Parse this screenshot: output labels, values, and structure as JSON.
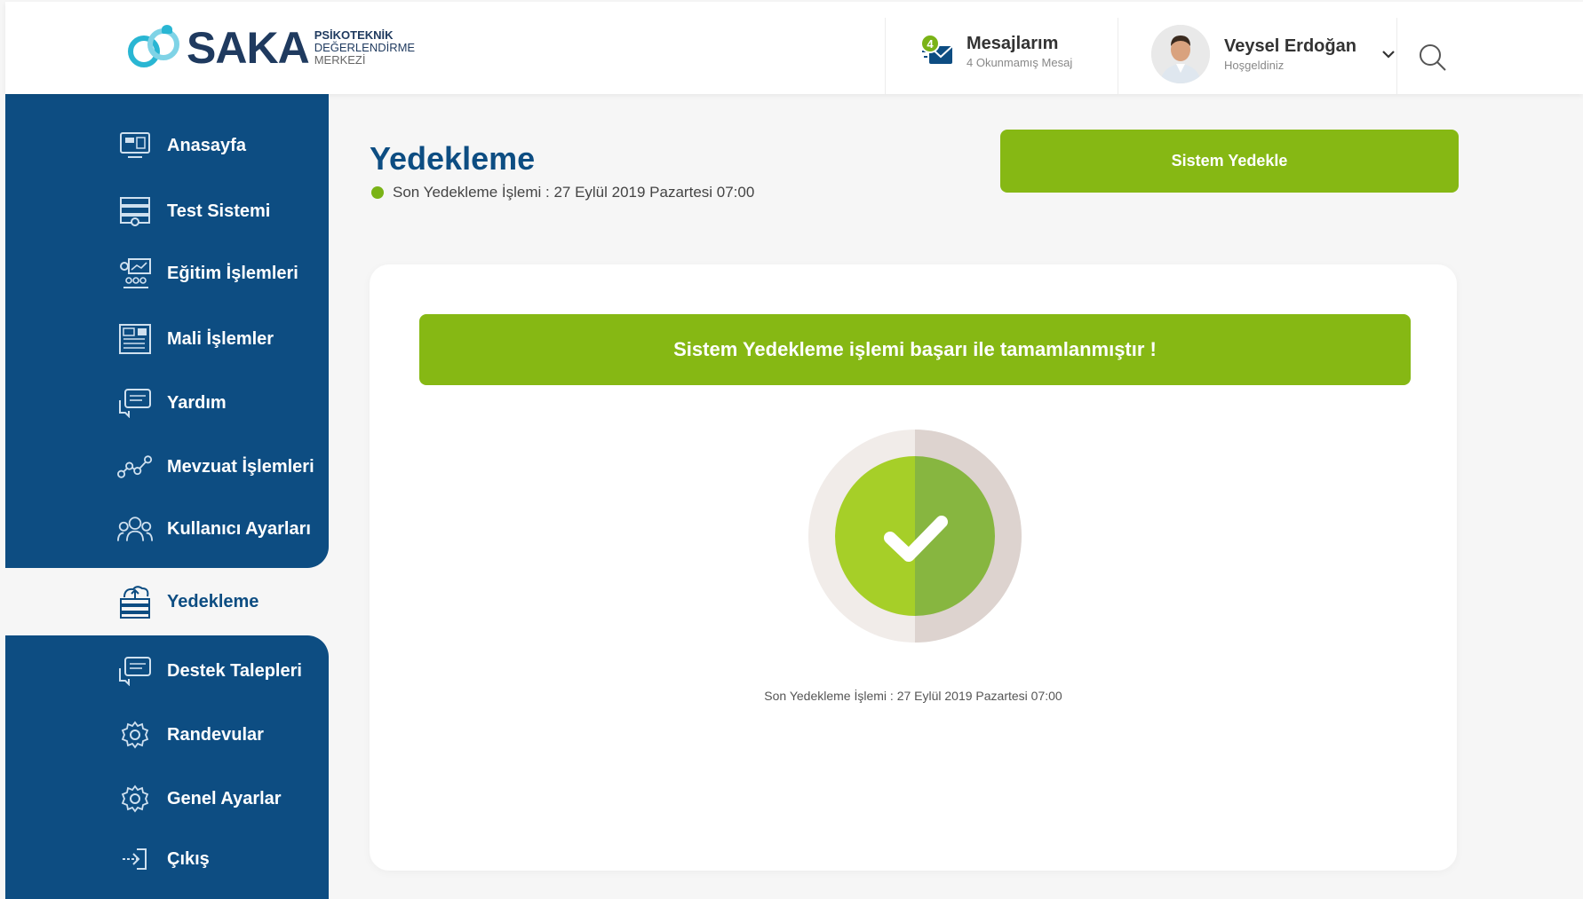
{
  "header": {
    "logo": {
      "name": "SAKA",
      "sub_line1": "PSİKOTEKNİK",
      "sub_line2": "DEĞERLENDİRME",
      "sub_line3": "MERKEZİ"
    },
    "messages": {
      "badge_count": "4",
      "title": "Mesajlarım",
      "subtitle": "4 Okunmamış Mesaj",
      "icon": "mail-icon"
    },
    "user": {
      "name": "Veysel Erdoğan",
      "subtitle": "Hoşgeldiniz",
      "icon": "chevron-down-icon"
    },
    "search_icon": "search-icon"
  },
  "sidebar": {
    "items": [
      {
        "label": "Anasayfa",
        "icon": "home-monitor-icon"
      },
      {
        "label": "Test Sistemi",
        "icon": "test-system-icon"
      },
      {
        "label": "Eğitim İşlemleri",
        "icon": "education-icon"
      },
      {
        "label": "Mali İşlemler",
        "icon": "finance-icon"
      },
      {
        "label": "Yardım",
        "icon": "help-chat-icon"
      },
      {
        "label": "Mevzuat İşlemleri",
        "icon": "regulation-icon"
      },
      {
        "label": "Kullanıcı Ayarları",
        "icon": "users-icon"
      },
      {
        "label": "Yedekleme",
        "icon": "backup-cloud-icon",
        "active": true
      },
      {
        "label": "Destek Talepleri",
        "icon": "support-chat-icon"
      },
      {
        "label": "Randevular",
        "icon": "gear-icon"
      },
      {
        "label": "Genel Ayarlar",
        "icon": "gear-icon"
      },
      {
        "label": "Çıkış",
        "icon": "logout-icon"
      }
    ]
  },
  "main": {
    "title": "Yedekleme",
    "last_backup": "Son Yedekleme İşlemi : 27 Eylül 2019 Pazartesi 07:00",
    "backup_button": "Sistem Yedekle",
    "success_message": "Sistem Yedekleme işlemi başarı ile tamamlanmıştır !",
    "card_footer": "Son Yedekleme İşlemi : 27 Eylül 2019 Pazartesi 07:00"
  },
  "colors": {
    "primary": "#0d4d82",
    "accent_green": "#86b814",
    "status_dot": "#7ab317"
  }
}
